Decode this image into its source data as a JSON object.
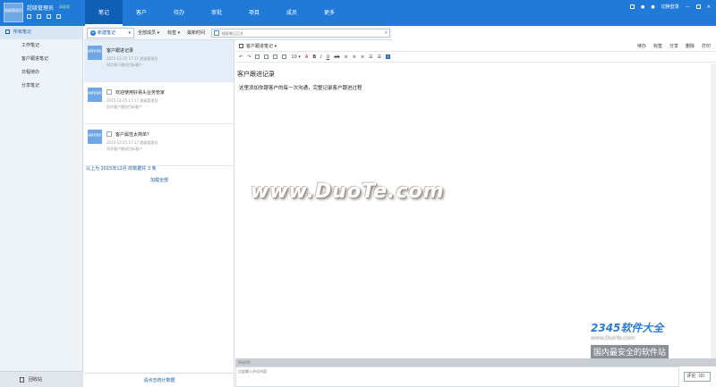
{
  "app": {
    "logo_text": "超级管理员",
    "title": "超级管理员",
    "tag": "高级版",
    "user": "切换登录"
  },
  "nav": {
    "tabs": [
      "笔记",
      "客户",
      "待办",
      "审批",
      "项目",
      "成员",
      "更多"
    ]
  },
  "sidebar": {
    "top": "所有笔记",
    "items": [
      "工作笔记",
      "客户跟进笔记",
      "日程待办",
      "分享笔记"
    ],
    "recycle": "回收站"
  },
  "toolbar": {
    "new_note": "新建笔记",
    "filters": [
      "全部成员",
      "标签",
      "最新时间"
    ],
    "search_placeholder": "搜索笔记正文"
  },
  "notes": [
    {
      "avatar": "超级管理员",
      "title": "客户跟进记录",
      "meta": "2015-12-25 17:17 超级管理员",
      "tag": "同步客户跟进目标客户"
    },
    {
      "avatar": "超级管理员",
      "title": "欢迎使用好易头业务管家",
      "meta": "2015-12-25 17:17 超级管理员",
      "tag": "同步客户跟进目标客户"
    },
    {
      "avatar": "超级管理员",
      "title": "客户属性太简单？",
      "meta": "2015-12-25 17:17 超级管理员",
      "tag": "同步客户跟进目标客户"
    }
  ],
  "list": {
    "summary": "以上为 2015年12月 的数据共 3 条",
    "load_all": "加载全部",
    "select_stats": "请点击统计数据"
  },
  "editor": {
    "note_type": "客户跟进笔记",
    "actions": [
      "待办",
      "标签",
      "分享",
      "删除",
      "打印"
    ],
    "font_size": "10",
    "title": "客户跟进记录",
    "body": "这里添加你跟客户的每一次沟通，完整记录客户跟进过程",
    "comment_label": "评论(0)",
    "comment_placeholder": "点此输入评论内容",
    "comment_button": "评论（0）"
  },
  "watermarks": {
    "center": "www.DuoTe.com",
    "corner_logo": "2345软件大全",
    "corner_site": "www.DuoTe.com",
    "corner_slogan": "国内最安全的软件站"
  },
  "colors": {
    "topbar": "#1f7ad8",
    "active_tab": "#0f5fb7",
    "sidebar": "#eef3f8",
    "selected_note": "#e3eef9"
  }
}
